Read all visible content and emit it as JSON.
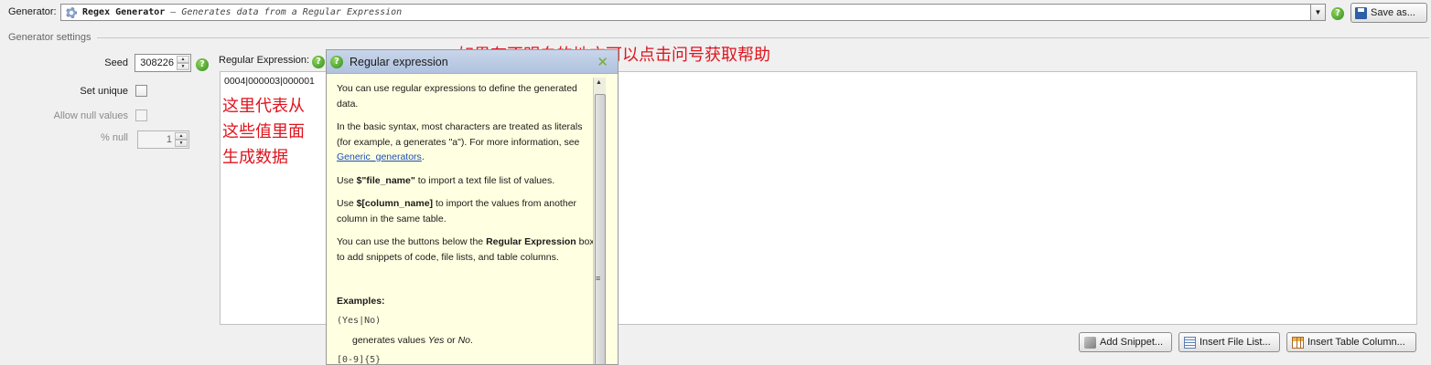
{
  "generator": {
    "label": "Generator:",
    "name": "Regex Generator",
    "description": "– Generates data from a Regular Expression",
    "save_label": "Save as..."
  },
  "settings": {
    "group_label": "Generator settings",
    "seed_label": "Seed",
    "seed_value": "308226",
    "set_unique_label": "Set unique",
    "allow_null_label": "Allow null values",
    "null_pct_label": "% null",
    "null_pct_value": "1"
  },
  "regex": {
    "label": "Regular Expression:",
    "value": "0004|000003|000001"
  },
  "help_popup": {
    "title": "Regular expression",
    "p1": "You can use regular expressions to define the generated data.",
    "p2_pre": "In the basic syntax, most characters are treated as literals (for example, a generates \"a\"). For more information, see ",
    "p2_link": "Generic_generators",
    "p2_post": ".",
    "p3_pre": "Use ",
    "p3_code": "$\"file_name\"",
    "p3_post": " to import a text file list of values.",
    "p4_pre": "Use ",
    "p4_code": "$[column_name]",
    "p4_post": " to import the values from another column in the same table.",
    "p5_pre": "You can use the buttons below the ",
    "p5_bold": "Regular Expression",
    "p5_post": " box to add snippets of code, file lists, and table columns.",
    "examples_label": "Examples:",
    "ex1_code": "(Yes|No)",
    "ex1_pre": "generates values ",
    "ex1_yes": "Yes",
    "ex1_or": " or ",
    "ex1_no": "No",
    "ex1_end": ".",
    "ex2_code": "[0-9]{5}"
  },
  "buttons": {
    "add_snippet": "Add Snippet...",
    "insert_file_list": "Insert File List...",
    "insert_table_column": "Insert Table  Column..."
  },
  "annotations": {
    "left": "这里代表从这些值里面生成数据",
    "top": "如果有不明白的地方可以点击问号获取帮助"
  },
  "colors": {
    "annotation": "#e0141e",
    "help_icon": "#3a9a26",
    "popup_bg": "#ffffe1",
    "link": "#1a4fb5"
  }
}
